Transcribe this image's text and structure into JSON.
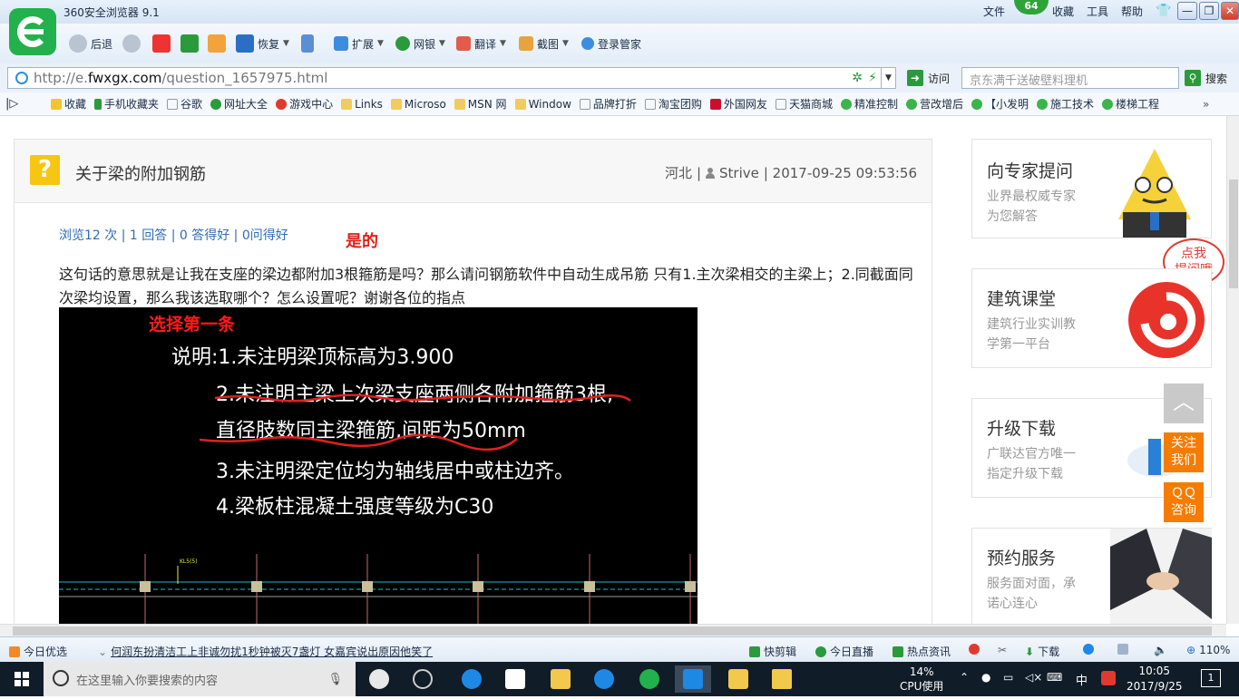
{
  "browser": {
    "title": "360安全浏览器 9.1",
    "menus": [
      "文件",
      "收藏",
      "工具",
      "帮助"
    ],
    "score": "64",
    "window_buttons": [
      "—",
      "❐",
      "✕"
    ]
  },
  "toolbar": {
    "back": "后退",
    "restore": "恢复",
    "extend": "扩展",
    "bank": "网银",
    "translate": "翻译",
    "screenshot": "截图",
    "login_manager": "登录管家"
  },
  "address": {
    "url_scheme": "http://e.",
    "url_host": "fwxgx.com",
    "url_path": "/question_1657975.html",
    "visit": "访问",
    "search_placeholder": "京东满千送破壁料理机",
    "search_button": "搜索"
  },
  "bookmarks": [
    "收藏",
    "手机收藏夹",
    "谷歌",
    "网址大全",
    "游戏中心",
    "Links",
    "Microso",
    "MSN 网",
    "Window",
    "品牌打折",
    "淘宝团购",
    "外国网友",
    "天猫商城",
    "精准控制",
    "营改增后",
    "【小发明",
    "施工技术",
    "楼梯工程"
  ],
  "question": {
    "title": "关于梁的附加钢筋",
    "location": "河北",
    "user": "Strive",
    "datetime": "| 2017-09-25 09:53:56",
    "stats": "浏览12 次 | 1 回答 | 0 答得好 | 0问得好",
    "answer_hint": "是的",
    "body": "这句话的意思就是让我在支座的梁边都附加3根箍筋是吗？那么请问钢筋软件中自动生成吊筋 只有1.主次梁相交的主梁上；2.同截面同次梁均设置，那么我该选取哪个？怎么设置呢？谢谢各位的指点",
    "image": {
      "caption": "选择第一条",
      "lines": [
        "说明:1.未注明梁顶标高为3.900",
        "2.未注明主梁上次梁支座两侧各附加箍筋3根,",
        "直径肢数同主梁箍筋,间距为50mm",
        "3.未注明梁定位均为轴线居中或柱边齐。",
        "4.梁板柱混凝土强度等级为C30"
      ],
      "tag": "KL5(5)"
    }
  },
  "sidebar": {
    "bubble": "点我\n提问哦",
    "cards": [
      {
        "title": "向专家提问",
        "sub1": "业界最权威专家",
        "sub2": "为您解答"
      },
      {
        "title": "建筑课堂",
        "sub1": "建筑行业实训教",
        "sub2": "学第一平台"
      },
      {
        "title": "升级下载",
        "sub1": "广联达官方唯一",
        "sub2": "指定升级下载"
      },
      {
        "title": "预约服务",
        "sub1": "服务面对面，承",
        "sub2": "诺心连心"
      }
    ],
    "float_follow": "关注\n我们",
    "float_qq": "ＱＱ\n咨询"
  },
  "statusbar": {
    "today": "今日优选",
    "news": "何润东扮清洁工上非诚勿扰1秒钟被灭7盏灯 女嘉宾说出原因他笑了",
    "quick_edit": "快剪辑",
    "live": "今日直播",
    "hot_news": "热点资讯",
    "download": "下载",
    "zoom": "110%"
  },
  "taskbar": {
    "search_placeholder": "在这里输入你要搜索的内容",
    "cpu_percent": "14%",
    "cpu_label": "CPU使用",
    "ime": "中",
    "time": "10:05",
    "date": "2017/9/25",
    "notifications": "1"
  },
  "colors": {
    "accent_green": "#22b14c",
    "link_blue": "#2f6db6",
    "answer_red": "#e0201a",
    "float_orange": "#f57c00"
  }
}
